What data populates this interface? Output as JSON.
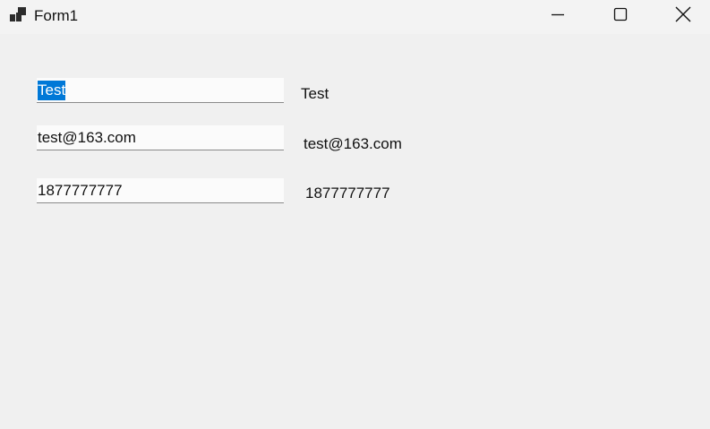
{
  "window": {
    "title": "Form1",
    "icon": "winforms-app-icon",
    "buttons": {
      "minimize": "minimize-icon",
      "maximize": "maximize-icon",
      "close": "close-icon"
    }
  },
  "form": {
    "fields": [
      {
        "value": "Test",
        "selected": true
      },
      {
        "value": "test@163.com"
      },
      {
        "value": "1877777777"
      }
    ],
    "labels": [
      "Test",
      "test@163.com",
      "1877777777"
    ]
  },
  "colors": {
    "selection": "#0078d7",
    "background": "#f0f0f0"
  }
}
